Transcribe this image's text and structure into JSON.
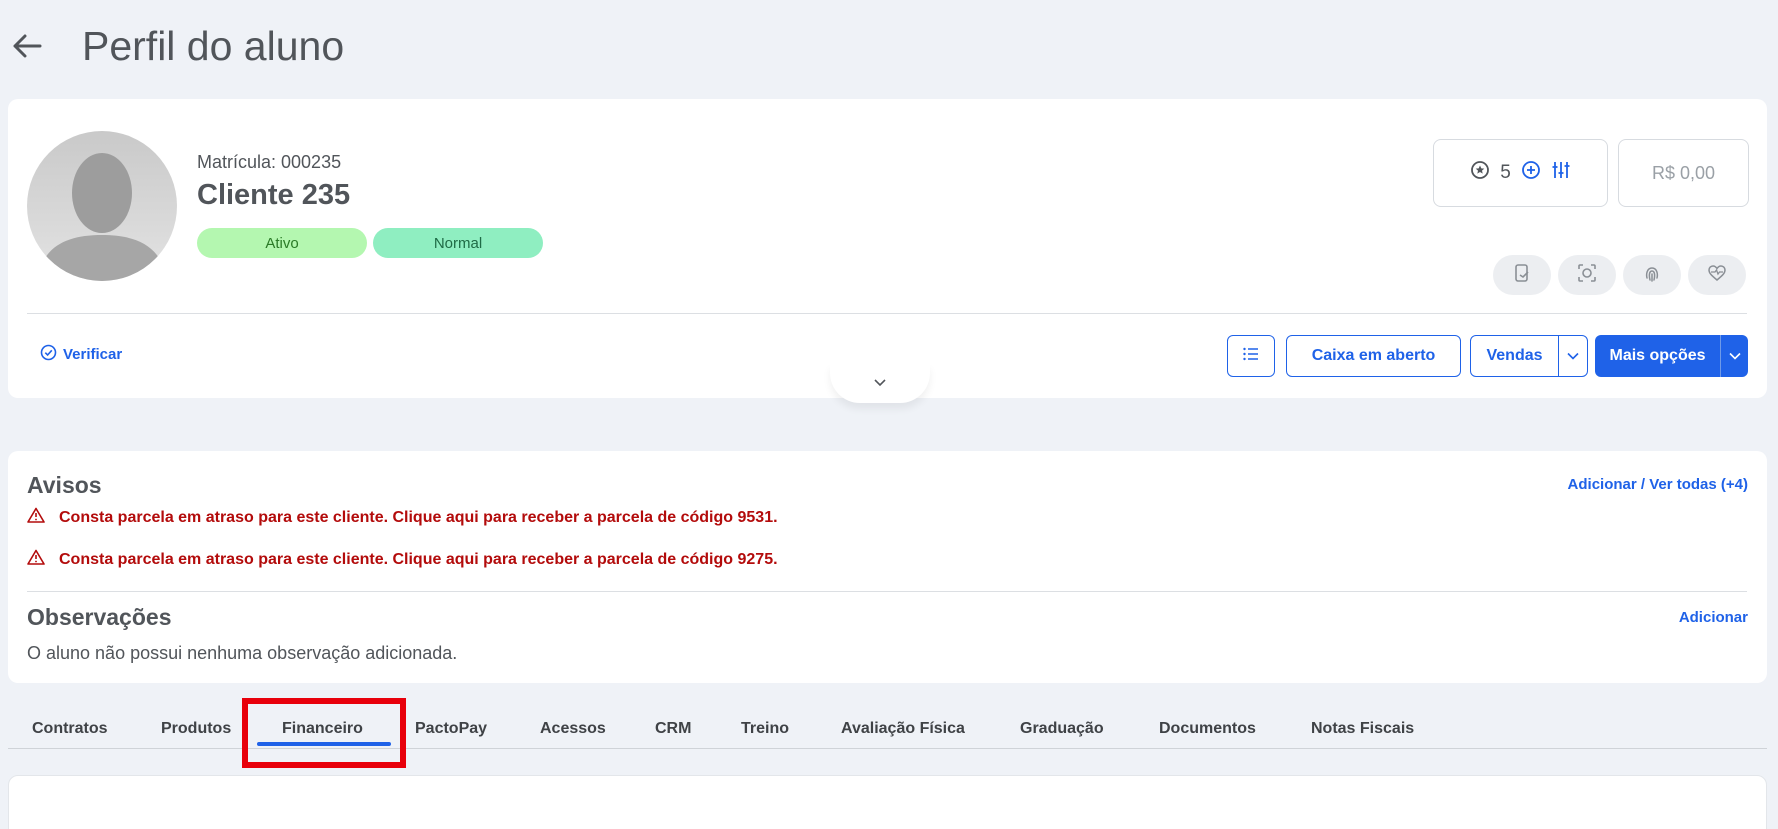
{
  "header": {
    "title": "Perfil do aluno"
  },
  "profile": {
    "matricula": "Matrícula: 000235",
    "name": "Cliente 235",
    "badges": [
      "Ativo",
      "Normal"
    ],
    "points": "5",
    "balance": "R$ 0,00"
  },
  "actions": {
    "verify": "Verificar",
    "caixa": "Caixa em aberto",
    "vendas": "Vendas",
    "mais": "Mais opções"
  },
  "avisos": {
    "title": "Avisos",
    "link": "Adicionar / Ver todas (+4)",
    "items": [
      "Consta parcela em atraso para este cliente. Clique aqui para receber a parcela de código 9531.",
      "Consta parcela em atraso para este cliente. Clique aqui para receber a parcela de código 9275."
    ]
  },
  "observacoes": {
    "title": "Observações",
    "link": "Adicionar",
    "empty": "O aluno não possui nenhuma observação adicionada."
  },
  "tabs": [
    "Contratos",
    "Produtos",
    "Financeiro",
    "PactoPay",
    "Acessos",
    "CRM",
    "Treino",
    "Avaliação Física",
    "Graduação",
    "Documentos",
    "Notas Fiscais"
  ],
  "active_tab": "Financeiro",
  "colors": {
    "accent": "#1f62e8",
    "alert": "#b30b0b",
    "highlight": "#e8000b"
  }
}
